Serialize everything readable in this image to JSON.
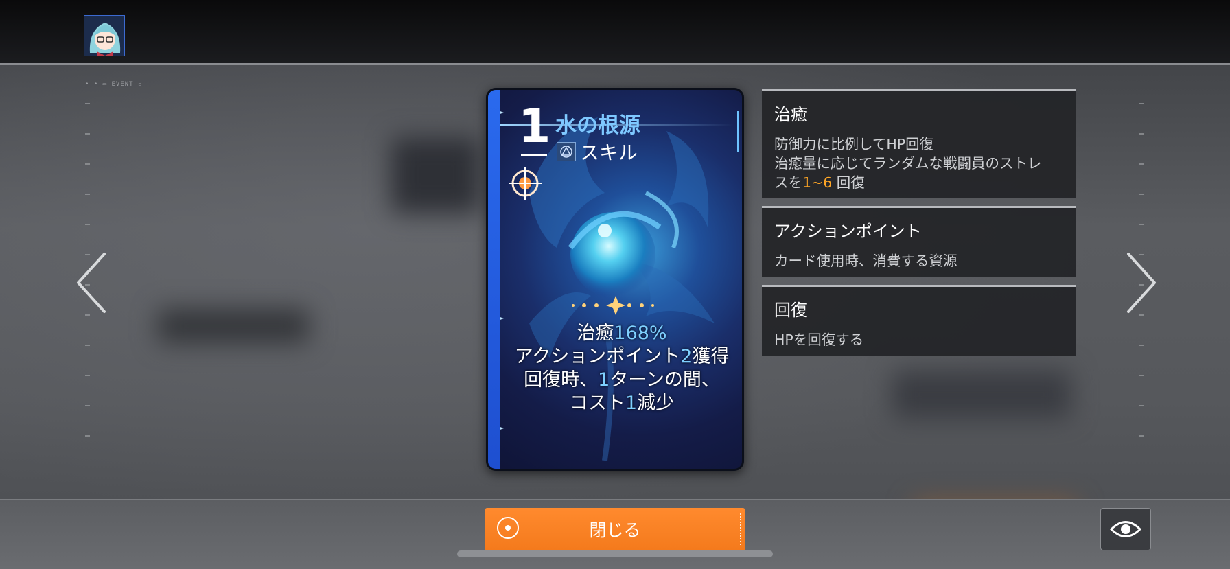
{
  "card": {
    "cost": "1",
    "title": "水の根源",
    "type_label": "スキル",
    "effect": {
      "line1_prefix": "治癒",
      "line1_value": "168%",
      "line2_prefix": "アクションポイント",
      "line2_value": "2",
      "line2_suffix": "獲得",
      "line3_prefix": "回復時、",
      "line3_value": "1",
      "line3_suffix": "ターンの間、",
      "line4_prefix": "コスト",
      "line4_value": "1",
      "line4_suffix": "減少"
    }
  },
  "panels": [
    {
      "title": "治癒",
      "line1": "防御力に比例してHP回復",
      "line2": "治癒量に応じてランダムな戦闘員のストレ",
      "line3_prefix": "スを",
      "line3_value": "1~6",
      "line3_suffix": " 回復"
    },
    {
      "title": "アクションポイント",
      "body": "カード使用時、消費する資源"
    },
    {
      "title": "回復",
      "body": "HPを回復する"
    }
  ],
  "footer": {
    "close_label": "閉じる"
  },
  "icons": {
    "avatar": "character-avatar",
    "prev": "chevron-left-icon",
    "next": "chevron-right-icon",
    "eye": "eye-icon",
    "type": "skill-type-icon",
    "target": "target-icon"
  },
  "colors": {
    "accent_orange": "#f47a1c",
    "highlight_blue": "#7ed0ff",
    "highlight_orange": "#ffa726"
  }
}
